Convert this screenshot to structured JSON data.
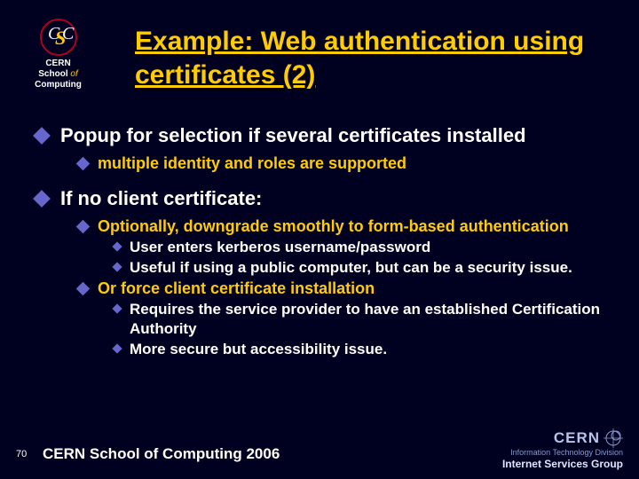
{
  "logo": {
    "line1": "CERN",
    "line2_a": "School",
    "line2_of": "of",
    "line2_b": "Computing"
  },
  "title": "Example: Web authentication using certificates (2)",
  "b1": {
    "text": "Popup for selection if several certificates installed",
    "s1": "multiple identity and roles are supported"
  },
  "b2": {
    "text": "If no client certificate:",
    "s1": {
      "text": "Optionally, downgrade smoothly to form-based authentication",
      "a": "User enters kerberos username/password",
      "b": "Useful if using a public computer, but can be a security issue."
    },
    "s2": {
      "text": "Or force client certificate installation",
      "a": "Requires the service provider to have an established Certification Authority",
      "b": "More secure but accessibility issue."
    }
  },
  "page_number": "70",
  "footer": "CERN School of Computing 2006",
  "footer_right": {
    "cern": "CERN",
    "division": "Information Technology Division",
    "group": "Internet Services Group"
  }
}
